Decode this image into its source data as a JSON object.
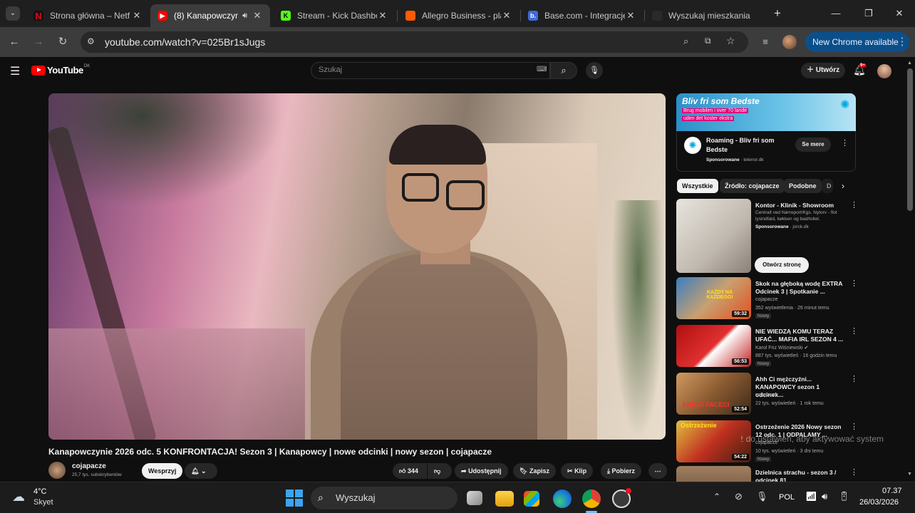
{
  "browser": {
    "tabs": [
      {
        "title": "Strona główna – Netf",
        "favicon_color": "#b00000"
      },
      {
        "title": "(8) Kanapowczyni",
        "favicon_color": "#ff0000"
      },
      {
        "title": "Stream - Kick Dashbo",
        "favicon_color": "#53fc18"
      },
      {
        "title": "Allegro Business - pla",
        "favicon_color": "#ff5a00"
      },
      {
        "title": "Base.com - Integracje",
        "favicon_color": "#3d6bdc"
      },
      {
        "title": "Wyszukaj mieszkania",
        "favicon_color": "#1f1f1f"
      }
    ],
    "url": "youtube.com/watch?v=025Br1sJugs",
    "new_chrome_label": "New Chrome available"
  },
  "youtube": {
    "logo_text": "YouTube",
    "logo_region": "DK",
    "search_placeholder": "Szukaj",
    "create_label": "Utwórz",
    "notifications_count": "9+"
  },
  "video": {
    "title": "Kanapowczynie 2026 odc. 5 KONFRONTACJA! Sezon 3 | Kanapowcy | nowe odcinki | nowy sezon | cojapacze",
    "channel": "cojapacze",
    "subscribers": "25,7 tys. subskrybentów",
    "support_label": "Wesprzyj",
    "likes": "344",
    "share_label": "Udostępnij",
    "save_label": "Zapisz",
    "clip_label": "Klip",
    "download_label": "Pobierz"
  },
  "ad": {
    "banner_title": "Bliv fri som Bedste",
    "banner_text_1": "Brug mobilen i over 70 lande",
    "banner_text_2": "uden det koster ekstra",
    "headline": "Roaming - Bliv fri som Bedste",
    "sponsored": "Sponsorowane",
    "domain": "telenor.dk",
    "cta": "Se mere"
  },
  "chips": [
    "Wszystkie",
    "Źródło: cojapacze",
    "Podobne",
    "D"
  ],
  "promo": {
    "title": "Kontor - Klinik - Showroom",
    "desc": "Centralt ved Nørreport/Kgs. Nytorv - flot lysindfald, køkken og bad/toilet.",
    "sponsored": "Sponsorowane",
    "domain": "jorck.dk",
    "cta": "Otwórz stronę"
  },
  "related": [
    {
      "title": "Skok na głęboką wodę EXTRA Odcinek 3 | Spotkanie ...",
      "channel": "cojapacze",
      "meta": "352 wyświetlenia · 26 minut temu",
      "badge": "Nowy",
      "duration": "59:32",
      "thumb_text": "KAŻDY NA KAŻDEGO!"
    },
    {
      "title": "NIE WIEDZĄ KOMU TERAZ UFAĆ... MAFIA IRL SEZON 4 ...",
      "channel": "Karol Friz Wiśniewski ✔",
      "meta": "887 tys. wyświetleń · 16 godzin temu",
      "badge": "Nowy",
      "duration": "56:53",
      "thumb_text": ""
    },
    {
      "title": "Ahh Ci mężczyźni... KANAPOWCY sezon 1 odcinek...",
      "channel": "cojapacze",
      "meta": "22 tys. wyświetleń · 1 rok temu",
      "badge": "",
      "duration": "52:54",
      "thumb_text": "AHH CI FACECI"
    },
    {
      "title": "Ostrzeżenie 2026 Nowy sezon 12 odc. 1 | ODPALAMY ...",
      "channel": "cojapacze",
      "meta": "10 tys. wyświetleń · 3 dni temu",
      "badge": "Nowy",
      "duration": "54:22",
      "thumb_text": "Ostrzeżenie"
    },
    {
      "title": "Dzielnica strachu - sezon 3 / odcinek 81",
      "channel": "",
      "meta": "",
      "badge": "",
      "duration": "",
      "thumb_text": ""
    }
  ],
  "windows_watermark": "Przejdź do ustawień, aby aktywować system",
  "taskbar": {
    "weather_temp": "4°C",
    "weather_desc": "Skyet",
    "search_label": "Wyszukaj",
    "lang": "POL",
    "time": "07.37",
    "date": "26/03/2026"
  }
}
